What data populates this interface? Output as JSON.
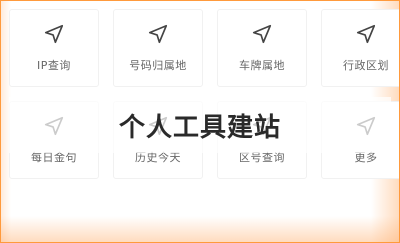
{
  "banner": {
    "title": "个人工具建站"
  },
  "tools": [
    {
      "label": "IP查询",
      "icon": "navigation-arrow-icon"
    },
    {
      "label": "号码归属地",
      "icon": "navigation-arrow-icon"
    },
    {
      "label": "车牌属地",
      "icon": "navigation-arrow-icon"
    },
    {
      "label": "行政区划",
      "icon": "navigation-arrow-icon"
    },
    {
      "label": "每日金句",
      "icon": "navigation-arrow-icon"
    },
    {
      "label": "历史今天",
      "icon": "navigation-arrow-icon"
    },
    {
      "label": "区号查询",
      "icon": "navigation-arrow-icon"
    },
    {
      "label": "更多",
      "icon": "navigation-arrow-icon"
    }
  ],
  "colors": {
    "accent_border": "#ff9a3c",
    "icon_stroke": "#444444",
    "label_text": "#666666"
  }
}
